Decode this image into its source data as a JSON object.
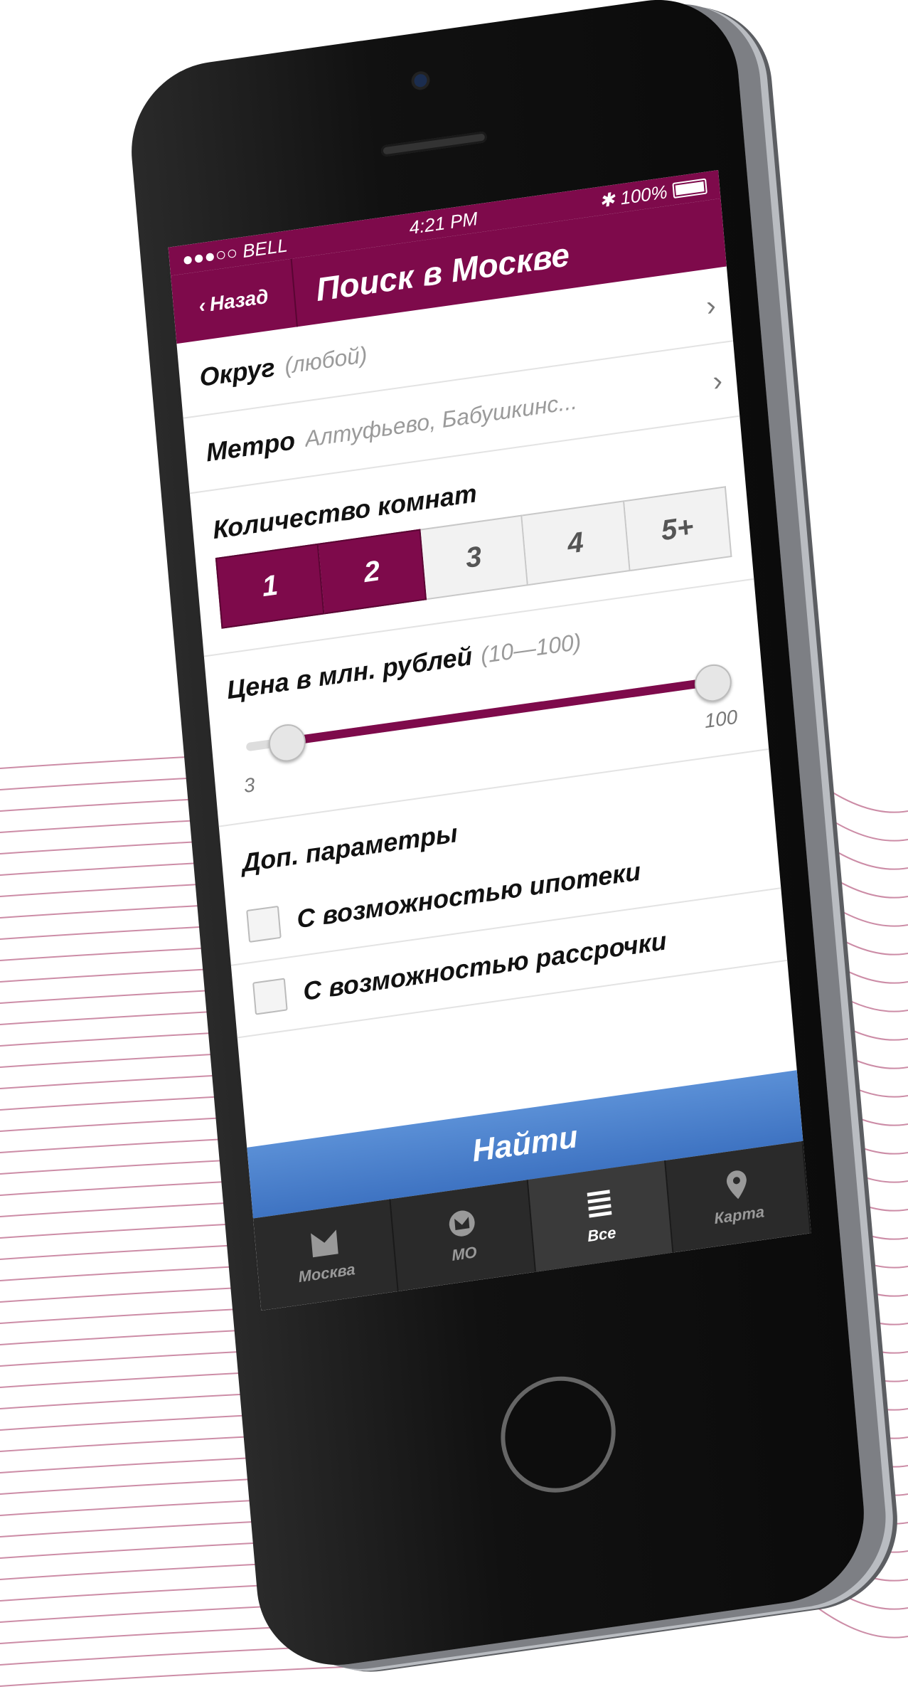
{
  "status_bar": {
    "carrier": "●●●○○ BELL",
    "time": "4:21 PM",
    "battery": "100%"
  },
  "nav": {
    "back_label": "Назад",
    "title": "Поиск в Москве"
  },
  "rows": [
    {
      "label": "Округ",
      "value": "(любой)"
    },
    {
      "label": "Метро",
      "value": "Алтуфьево, Бабушкинс..."
    }
  ],
  "rooms": {
    "label": "Количество комнат",
    "options": [
      "1",
      "2",
      "3",
      "4",
      "5+"
    ],
    "selected": [
      "1",
      "2"
    ]
  },
  "price": {
    "label": "Цена в млн. рублей",
    "range_text": "(10—100)",
    "min_label": "3",
    "max_label": "100",
    "low_fraction": 0.05,
    "high_fraction": 1.0
  },
  "extra": {
    "label": "Доп. параметры",
    "options": [
      "С возможностью ипотеки",
      "С возможностью рассрочки"
    ]
  },
  "find_button": "Найти",
  "tabs": [
    {
      "label": "Москва",
      "icon": "moscow-icon"
    },
    {
      "label": "МО",
      "icon": "mo-icon"
    },
    {
      "label": "Все",
      "icon": "list-icon",
      "active": true
    },
    {
      "label": "Карта",
      "icon": "map-pin-icon"
    }
  ],
  "colors": {
    "accent": "#7e0a4b",
    "button": "#4a7fcc",
    "tabbar": "#2a2a2a"
  }
}
